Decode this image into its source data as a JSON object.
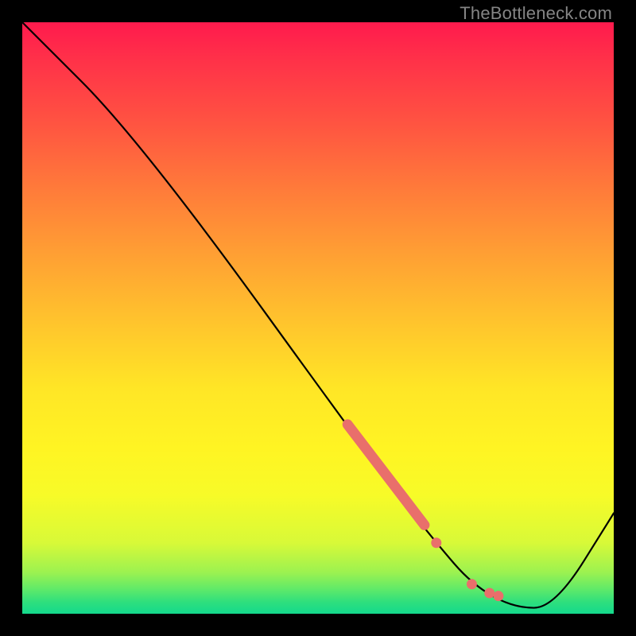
{
  "attribution": "TheBottleneck.com",
  "chart_data": {
    "type": "line",
    "title": "",
    "xlabel": "",
    "ylabel": "",
    "xlim": [
      0,
      100
    ],
    "ylim": [
      0,
      100
    ],
    "series": [
      {
        "name": "curve",
        "x": [
          0,
          20,
          62,
          70,
          76,
          83,
          90,
          100
        ],
        "y": [
          100,
          80,
          22,
          12,
          5,
          1,
          1,
          17
        ]
      }
    ],
    "highlight_segment": {
      "name": "thick-salmon-stroke",
      "color": "#e96f6b",
      "x": [
        55,
        68
      ],
      "y": [
        32,
        15
      ]
    },
    "dots": {
      "name": "salmon-dots",
      "color": "#e96f6b",
      "points": [
        {
          "x": 70,
          "y": 12
        },
        {
          "x": 76,
          "y": 5
        },
        {
          "x": 79,
          "y": 3.5
        },
        {
          "x": 80.5,
          "y": 3
        }
      ]
    }
  }
}
